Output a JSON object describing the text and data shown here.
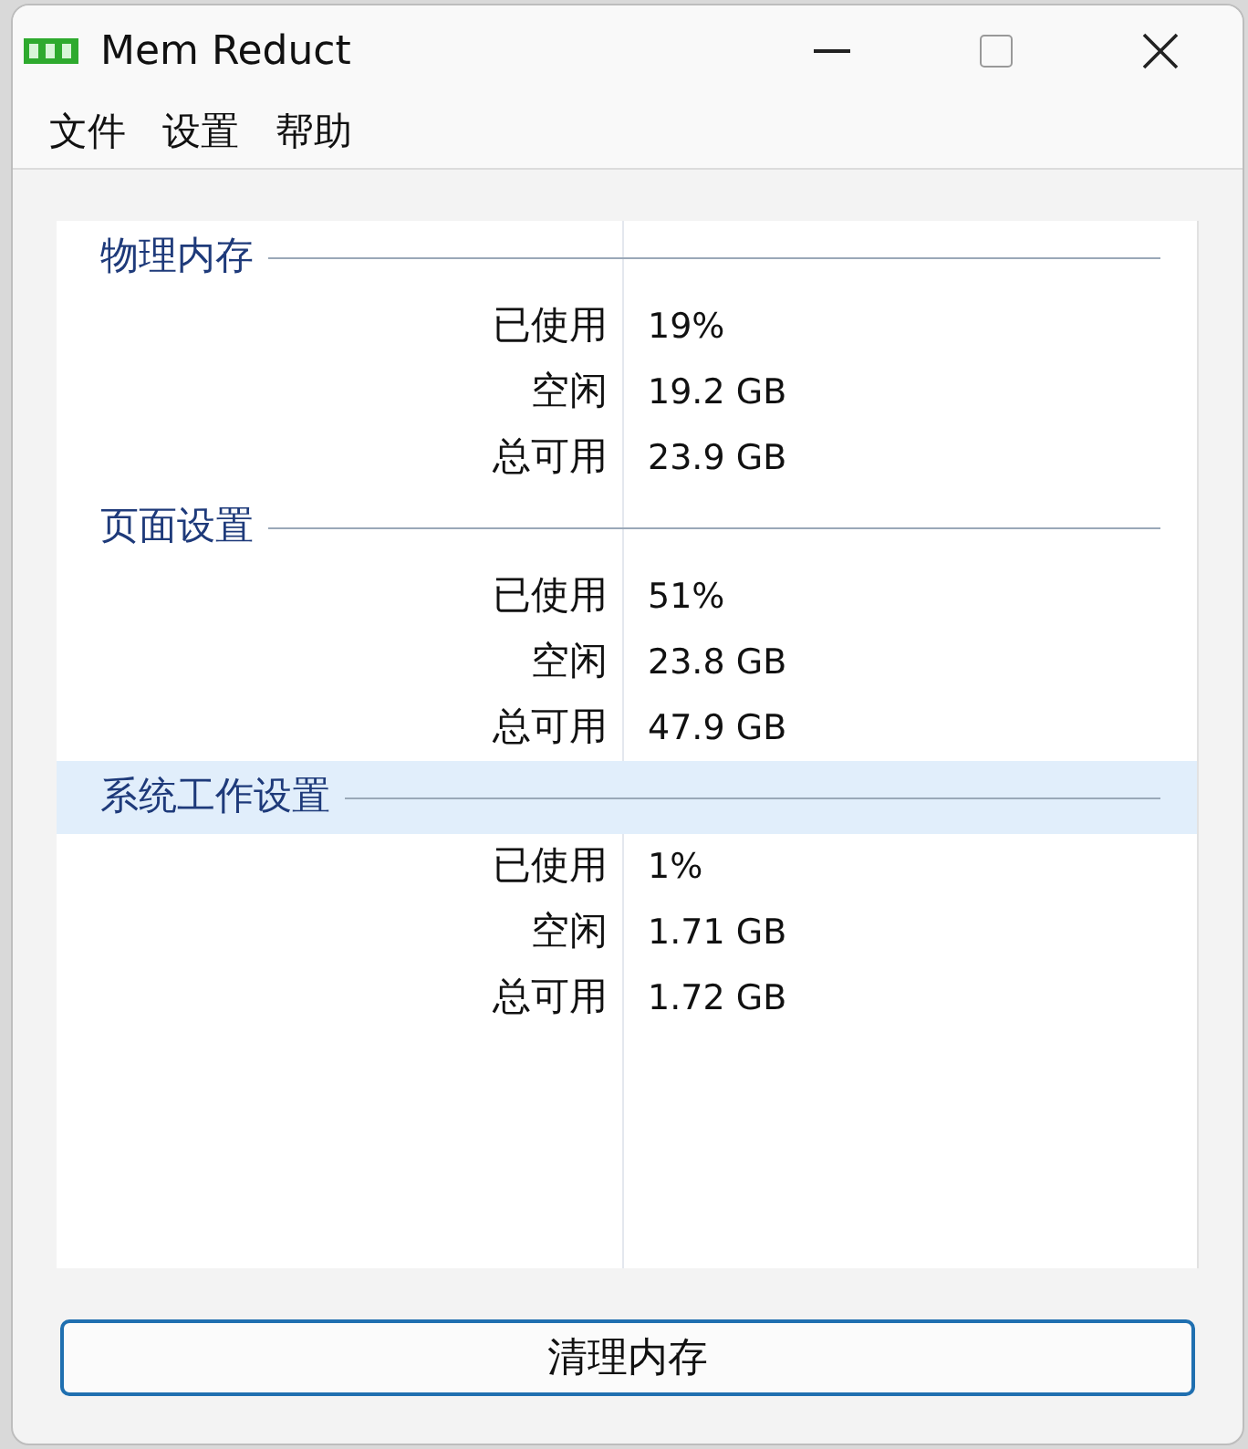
{
  "window": {
    "title": "Mem Reduct"
  },
  "menu": [
    "文件",
    "设置",
    "帮助"
  ],
  "groups": [
    {
      "title": "物理内存",
      "selected": false,
      "rows": [
        {
          "label": "已使用",
          "value": "19%"
        },
        {
          "label": "空闲",
          "value": "19.2 GB"
        },
        {
          "label": "总可用",
          "value": "23.9 GB"
        }
      ]
    },
    {
      "title": "页面设置",
      "selected": false,
      "rows": [
        {
          "label": "已使用",
          "value": "51%"
        },
        {
          "label": "空闲",
          "value": "23.8 GB"
        },
        {
          "label": "总可用",
          "value": "47.9 GB"
        }
      ]
    },
    {
      "title": "系统工作设置",
      "selected": true,
      "rows": [
        {
          "label": "已使用",
          "value": "1%"
        },
        {
          "label": "空闲",
          "value": "1.71 GB"
        },
        {
          "label": "总可用",
          "value": "1.72 GB"
        }
      ]
    }
  ],
  "button": "清理内存"
}
